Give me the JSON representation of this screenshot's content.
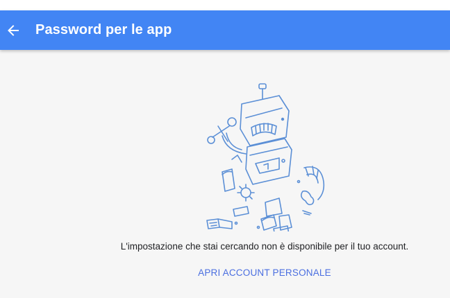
{
  "app_bar": {
    "title": "Password per le app",
    "back_icon": "arrow-left-icon",
    "color": "#4285f4"
  },
  "main": {
    "illustration": "broken-robot-icon",
    "message": "L'impostazione che stai cercando non è disponibile per il tuo account.",
    "action_label": "APRI ACCOUNT PERSONALE",
    "accent_color": "#4a6ee0"
  }
}
